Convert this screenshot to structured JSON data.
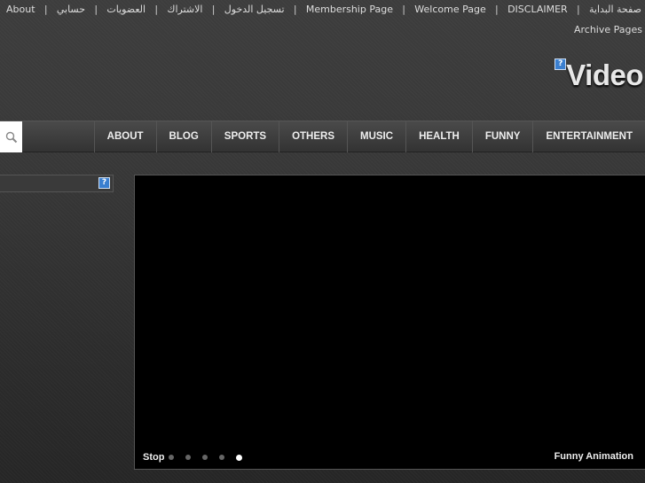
{
  "top_links": [
    "About",
    "حسابي",
    "العضويات",
    "الاشتراك",
    "تسجيل الدخول",
    "Membership Page",
    "Welcome Page",
    "DISCLAIMER",
    "صفحة البداية"
  ],
  "archive_link": "Archive Pages",
  "logo": {
    "text": "Video",
    "broken_image": "?"
  },
  "nav": {
    "search_icon": "magnifier-icon",
    "items": [
      "ABOUT",
      "BLOG",
      "SPORTS",
      "OTHERS",
      "MUSIC",
      "HEALTH",
      "FUNNY",
      "ENTERTAINMENT"
    ]
  },
  "sidebar": {
    "broken_image": "?"
  },
  "slider": {
    "stop_label": "Stop",
    "slide_count": 5,
    "active_slide": 5,
    "caption": "Funny Animation"
  }
}
